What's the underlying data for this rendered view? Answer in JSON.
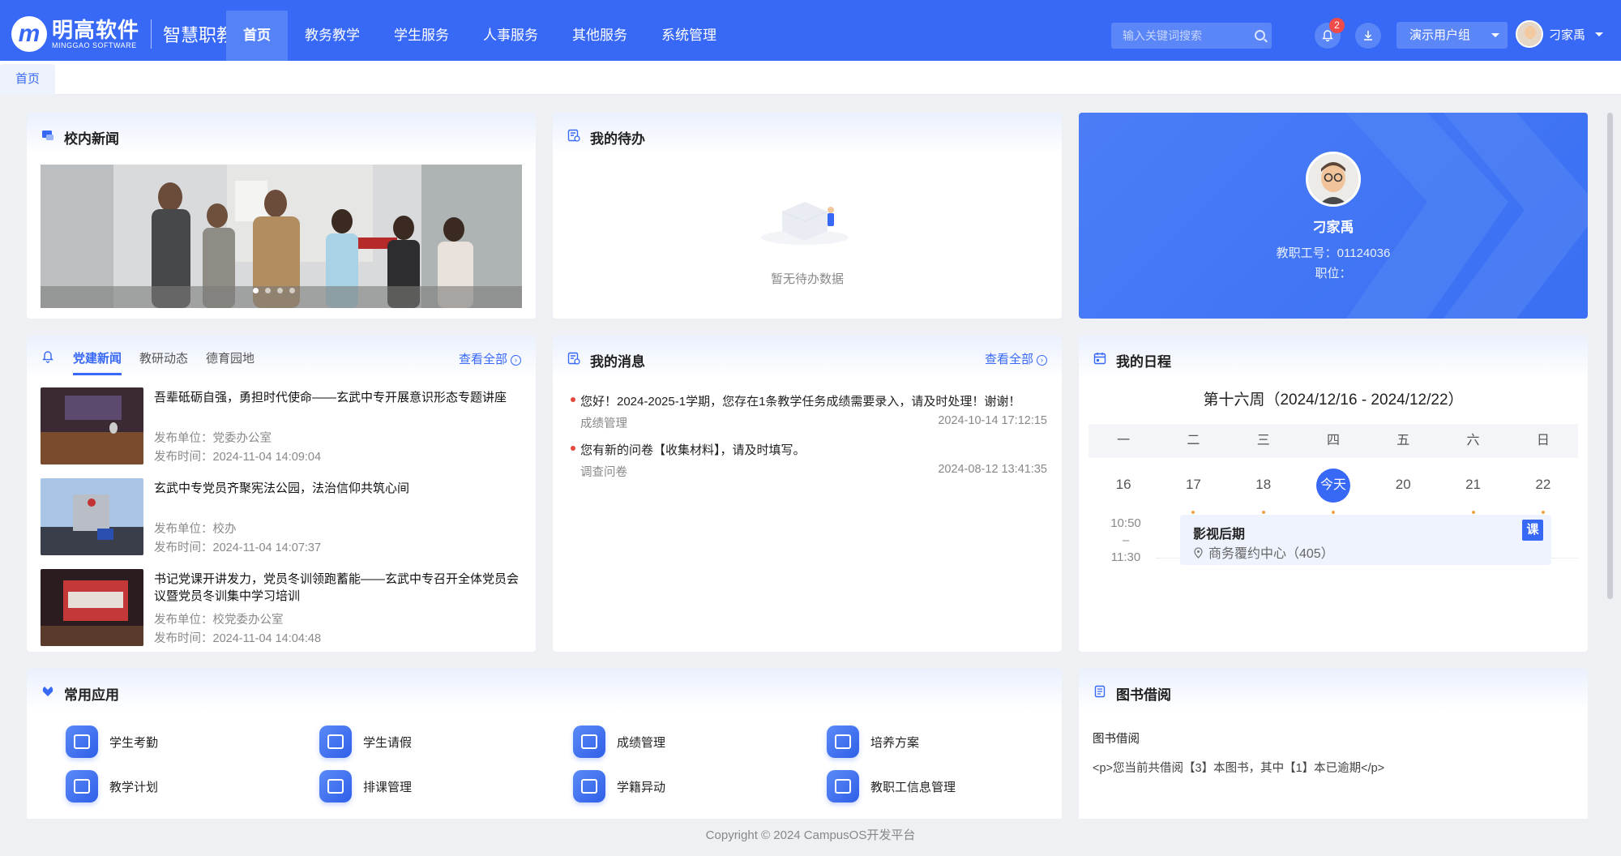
{
  "brand": {
    "name": "明高软件",
    "name_en": "MINGGAO SOFTWARE",
    "sub": "智慧职教"
  },
  "nav": {
    "items": [
      "首页",
      "教务教学",
      "学生服务",
      "人事服务",
      "其他服务",
      "系统管理"
    ],
    "active": 0
  },
  "search": {
    "placeholder": "输入关键词搜索"
  },
  "notify": {
    "count": "2"
  },
  "group_select": {
    "value": "演示用户组"
  },
  "user": {
    "name": "刁家禹"
  },
  "tabs": [
    "首页"
  ],
  "news_panel": {
    "title": "校内新闻"
  },
  "todo": {
    "title": "我的待办",
    "empty": "暂无待办数据"
  },
  "profile": {
    "name": "刁家禹",
    "id_line": "教职工号：01124036",
    "position_line": "职位："
  },
  "party": {
    "tabs": [
      "党建新闻",
      "教研动态",
      "德育园地"
    ],
    "more": "查看全部",
    "items": [
      {
        "title": "吾辈砥砺自强，勇担时代使命——玄武中专开展意识形态专题讲座",
        "unit": "发布单位：党委办公室",
        "time": "发布时间：2024-11-04 14:09:04"
      },
      {
        "title": "玄武中专党员齐聚宪法公园，法治信仰共筑心间",
        "unit": "发布单位：校办",
        "time": "发布时间：2024-11-04 14:07:37"
      },
      {
        "title": "书记党课开讲发力，党员冬训领跑蓄能——玄武中专召开全体党员会议暨党员冬训集中学习培训",
        "unit": "发布单位：校党委办公室",
        "time": "发布时间：2024-11-04 14:04:48"
      }
    ]
  },
  "messages": {
    "title": "我的消息",
    "more": "查看全部",
    "items": [
      {
        "text": "您好！2024-2025-1学期，您存在1条教学任务成绩需要录入，请及时处理！谢谢！",
        "source": "成绩管理",
        "time": "2024-10-14 17:12:15"
      },
      {
        "text": "您有新的问卷【收集材料】，请及时填写。",
        "source": "调查问卷",
        "time": "2024-08-12 13:41:35"
      }
    ]
  },
  "schedule": {
    "title": "我的日程",
    "week": "第十六周（2024/12/16 - 2024/12/22）",
    "weekdays": [
      "一",
      "二",
      "三",
      "四",
      "五",
      "六",
      "日"
    ],
    "days": [
      "16",
      "17",
      "18",
      "今天",
      "20",
      "21",
      "22"
    ],
    "time_start": "10:50",
    "time_sep": "–",
    "time_end": "11:30",
    "event": {
      "title": "影视后期",
      "location": "商务覆约中心（405）",
      "tag": "课"
    }
  },
  "apps": {
    "title": "常用应用",
    "items": [
      "学生考勤",
      "学生请假",
      "成绩管理",
      "培养方案",
      "教学计划",
      "排课管理",
      "学籍异动",
      "教职工信息管理"
    ]
  },
  "books": {
    "title": "图书借阅",
    "heading": "图书借阅",
    "text": "<p>您当前共借阅【3】本图书，其中【1】本已逾期</p>"
  },
  "footer": "Copyright © 2024 CampusOS开发平台",
  "colors": {
    "primary": "#3768f6",
    "badge": "#ef4b4b",
    "bg": "#eef0f4"
  }
}
